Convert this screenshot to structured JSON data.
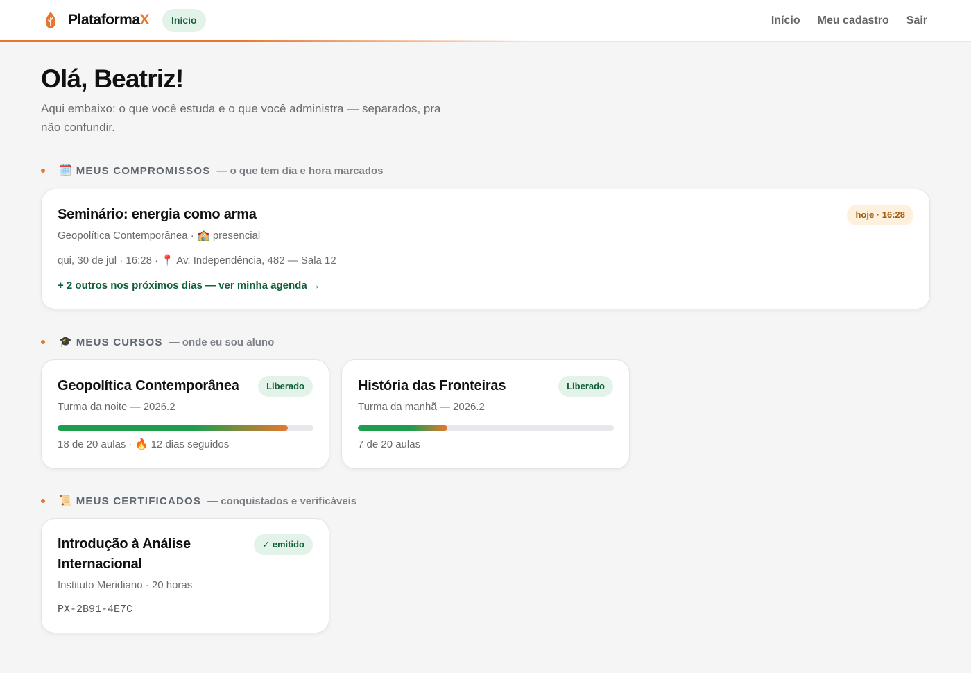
{
  "header": {
    "brand_main": "Plataforma",
    "brand_accent": "X",
    "pill_label": "Início",
    "nav": [
      "Início",
      "Meu cadastro",
      "Sair"
    ]
  },
  "greeting": {
    "title": "Olá, Beatriz!",
    "subtitle": "Aqui embaixo: o que você estuda e o que você administra — separados, pra não confundir."
  },
  "sections": {
    "commitments": {
      "emoji": "🗓️",
      "title": "MEUS COMPROMISSOS",
      "hint": "— o que tem dia e hora marcados"
    },
    "courses": {
      "emoji": "🎓",
      "title": "MEUS CURSOS",
      "hint": "— onde eu sou aluno"
    },
    "certificates": {
      "emoji": "📜",
      "title": "MEUS CERTIFICADOS",
      "hint": "— conquistados e verificáveis"
    }
  },
  "commitment": {
    "title": "Seminário: energia como arma",
    "course": "Geopolítica Contemporânea",
    "mode_emoji": "🏫",
    "mode": "presencial",
    "date": "qui, 30 de jul · 16:28 ·",
    "pin_emoji": "📍",
    "location": "Av. Independência, 482 — Sala 12",
    "badge": "hoje · 16:28",
    "more_link": "+ 2 outros nos próximos dias — ver minha agenda →"
  },
  "courses": [
    {
      "title": "Geopolítica Contemporânea",
      "badge": "Liberado",
      "class": "Turma da noite — 2026.2",
      "progress": 0.9,
      "lessons": "18 de 20 aulas ·",
      "streak_emoji": "🔥",
      "streak": "12 dias seguidos"
    },
    {
      "title": "História das Fronteiras",
      "badge": "Liberado",
      "class": "Turma da manhã — 2026.2",
      "progress": 0.35,
      "lessons": "7 de 20 aulas"
    }
  ],
  "certificate": {
    "title_line1": "Introdução à Análise",
    "title_line2": "Internacional",
    "badge": "✓ emitido",
    "issuer": "Instituto Meridiano · 20 horas",
    "code": "PX-2B91-4E7C"
  },
  "colors": {
    "accent": "#e8772e",
    "green": "#11603a",
    "progress_start": "#1f9d4f"
  }
}
